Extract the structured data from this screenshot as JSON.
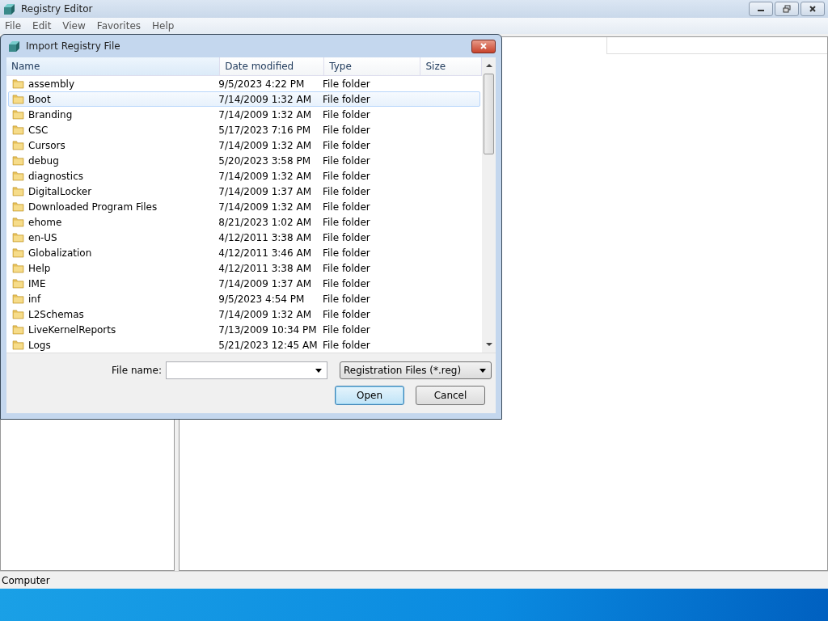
{
  "window": {
    "title": "Registry Editor",
    "menu": [
      "File",
      "Edit",
      "View",
      "Favorites",
      "Help"
    ]
  },
  "status_bar": "Computer",
  "dialog": {
    "title": "Import Registry File",
    "columns": [
      "Name",
      "Date modified",
      "Type",
      "Size"
    ],
    "rows": [
      {
        "name": "assembly",
        "date": "9/5/2023 4:22 PM",
        "type": "File folder",
        "selected": false
      },
      {
        "name": "Boot",
        "date": "7/14/2009 1:32 AM",
        "type": "File folder",
        "selected": true
      },
      {
        "name": "Branding",
        "date": "7/14/2009 1:32 AM",
        "type": "File folder",
        "selected": false
      },
      {
        "name": "CSC",
        "date": "5/17/2023 7:16 PM",
        "type": "File folder",
        "selected": false
      },
      {
        "name": "Cursors",
        "date": "7/14/2009 1:32 AM",
        "type": "File folder",
        "selected": false
      },
      {
        "name": "debug",
        "date": "5/20/2023 3:58 PM",
        "type": "File folder",
        "selected": false
      },
      {
        "name": "diagnostics",
        "date": "7/14/2009 1:32 AM",
        "type": "File folder",
        "selected": false
      },
      {
        "name": "DigitalLocker",
        "date": "7/14/2009 1:37 AM",
        "type": "File folder",
        "selected": false
      },
      {
        "name": "Downloaded Program Files",
        "date": "7/14/2009 1:32 AM",
        "type": "File folder",
        "selected": false
      },
      {
        "name": "ehome",
        "date": "8/21/2023 1:02 AM",
        "type": "File folder",
        "selected": false
      },
      {
        "name": "en-US",
        "date": "4/12/2011 3:38 AM",
        "type": "File folder",
        "selected": false
      },
      {
        "name": "Globalization",
        "date": "4/12/2011 3:46 AM",
        "type": "File folder",
        "selected": false
      },
      {
        "name": "Help",
        "date": "4/12/2011 3:38 AM",
        "type": "File folder",
        "selected": false
      },
      {
        "name": "IME",
        "date": "7/14/2009 1:37 AM",
        "type": "File folder",
        "selected": false
      },
      {
        "name": "inf",
        "date": "9/5/2023 4:54 PM",
        "type": "File folder",
        "selected": false
      },
      {
        "name": "L2Schemas",
        "date": "7/14/2009 1:32 AM",
        "type": "File folder",
        "selected": false
      },
      {
        "name": "LiveKernelReports",
        "date": "7/13/2009 10:34 PM",
        "type": "File folder",
        "selected": false
      },
      {
        "name": "Logs",
        "date": "5/21/2023 12:45 AM",
        "type": "File folder",
        "selected": false
      }
    ],
    "file_name_label": "File name:",
    "file_type": "Registration Files (*.reg)",
    "buttons": [
      "Open",
      "Cancel"
    ]
  }
}
